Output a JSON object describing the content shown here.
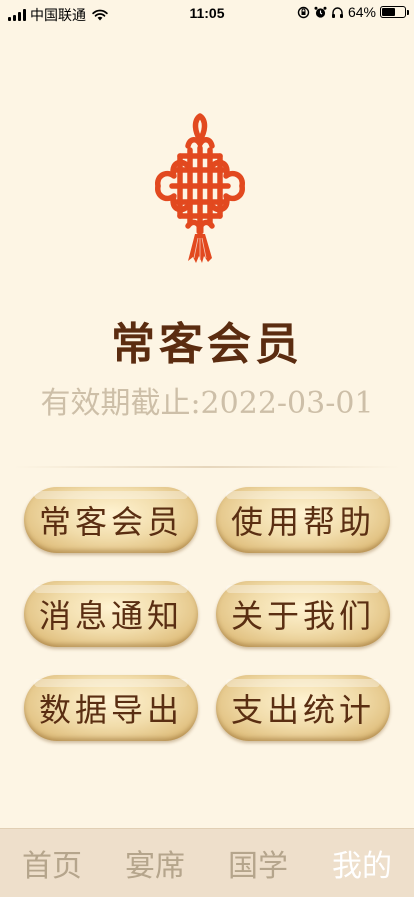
{
  "status_bar": {
    "carrier": "中国联通",
    "time": "11:05",
    "battery_percent": "64%",
    "battery_level": 0.64
  },
  "membership": {
    "title": "常客会员",
    "expiry": "有效期截止:2022-03-01"
  },
  "menu": {
    "member": "常客会员",
    "help": "使用帮助",
    "messages": "消息通知",
    "about": "关于我们",
    "export": "数据导出",
    "stats": "支出统计"
  },
  "tabbar": {
    "home": "首页",
    "banquet": "宴席",
    "guoxue": "国学",
    "mine": "我的",
    "active_tab": "mine"
  },
  "colors": {
    "background": "#fdf5e4",
    "knot": "#e2491f",
    "title": "#5b2c10",
    "button": "#f1dcaa",
    "tab_inactive": "#b5a58c",
    "tab_active": "#ffffff"
  }
}
